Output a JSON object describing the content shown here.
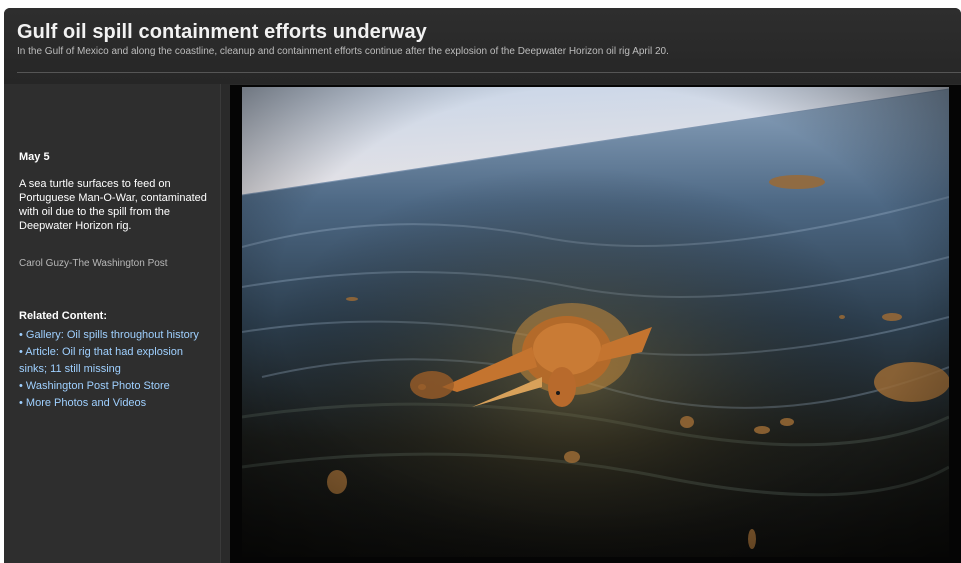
{
  "gallery": {
    "title": "Gulf oil spill containment efforts underway",
    "subtitle": "In the Gulf of Mexico and along the coastline, cleanup and containment efforts continue after the explosion of the Deepwater Horizon oil rig April 20."
  },
  "sidebar": {
    "date": "May 5",
    "caption": "A sea turtle surfaces to feed on Portuguese Man-O-War, contaminated with oil due to the spill from the Deepwater Horizon rig.",
    "credit": "Carol Guzy-The Washington Post",
    "related_heading": "Related Content:",
    "related_links": [
      {
        "label": "• Gallery: Oil spills throughout history"
      },
      {
        "label": "• Article: Oil rig that had explosion sinks; 11 still missing"
      },
      {
        "label": "• Washington Post Photo Store"
      },
      {
        "label": "• More Photos and Videos"
      }
    ]
  },
  "photo": {
    "subject": "sea-turtle-in-oil-slick"
  },
  "colors": {
    "background": "#2a2a2a",
    "link": "#9fd0ff",
    "title": "#f2f2f2"
  }
}
